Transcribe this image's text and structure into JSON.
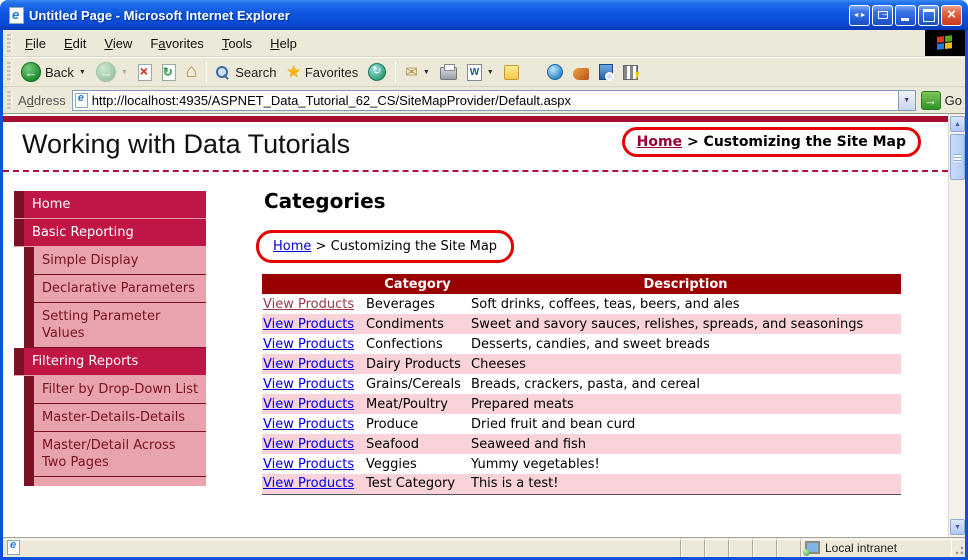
{
  "window": {
    "title": "Untitled Page - Microsoft Internet Explorer"
  },
  "menu": {
    "items": [
      {
        "label": "File",
        "accel": 0
      },
      {
        "label": "Edit",
        "accel": 0
      },
      {
        "label": "View",
        "accel": 0
      },
      {
        "label": "Favorites",
        "accel": 1
      },
      {
        "label": "Tools",
        "accel": 0
      },
      {
        "label": "Help",
        "accel": 0
      }
    ]
  },
  "toolbar": {
    "back": "Back",
    "search": "Search",
    "favorites": "Favorites"
  },
  "address": {
    "label": "Address",
    "url": "http://localhost:4935/ASPNET_Data_Tutorial_62_CS/SiteMapProvider/Default.aspx",
    "go": "Go"
  },
  "page": {
    "site_title": "Working with Data Tutorials",
    "top_breadcrumb": {
      "home": "Home",
      "sep": ">",
      "current": "Customizing the Site Map"
    },
    "heading": "Categories",
    "breadcrumb": {
      "home": "Home",
      "sep": ">",
      "current": "Customizing the Site Map"
    },
    "sidebar": [
      {
        "label": "Home",
        "level": 1
      },
      {
        "label": "Basic Reporting",
        "level": 1
      },
      {
        "label": "Simple Display",
        "level": 2
      },
      {
        "label": "Declarative Parameters",
        "level": 2
      },
      {
        "label": "Setting Parameter Values",
        "level": 2
      },
      {
        "label": "Filtering Reports",
        "level": 1
      },
      {
        "label": "Filter by Drop-Down List",
        "level": 2
      },
      {
        "label": "Master-Details-Details",
        "level": 2
      },
      {
        "label": "Master/Detail Across Two Pages",
        "level": 2
      }
    ],
    "table": {
      "headers": [
        "",
        "Category",
        "Description"
      ],
      "link_label": "View Products",
      "rows": [
        {
          "category": "Beverages",
          "description": "Soft drinks, coffees, teas, beers, and ales",
          "visited": true
        },
        {
          "category": "Condiments",
          "description": "Sweet and savory sauces, relishes, spreads, and seasonings"
        },
        {
          "category": "Confections",
          "description": "Desserts, candies, and sweet breads"
        },
        {
          "category": "Dairy Products",
          "description": "Cheeses"
        },
        {
          "category": "Grains/Cereals",
          "description": "Breads, crackers, pasta, and cereal"
        },
        {
          "category": "Meat/Poultry",
          "description": "Prepared meats"
        },
        {
          "category": "Produce",
          "description": "Dried fruit and bean curd"
        },
        {
          "category": "Seafood",
          "description": "Seaweed and fish"
        },
        {
          "category": "Veggies",
          "description": "Yummy vegetables!"
        },
        {
          "category": "Test Category",
          "description": "This is a test!"
        }
      ]
    }
  },
  "status": {
    "zone": "Local intranet"
  },
  "colors": {
    "title_blue": "#0D52DC",
    "crimson": "#BF1646",
    "maroon": "#7A1124",
    "sub_pink": "#E8A3AC",
    "row_pink": "#F9D2DA",
    "header_red": "#990000",
    "annotation_red": "#E80000",
    "top_bar": "#A50D32"
  }
}
